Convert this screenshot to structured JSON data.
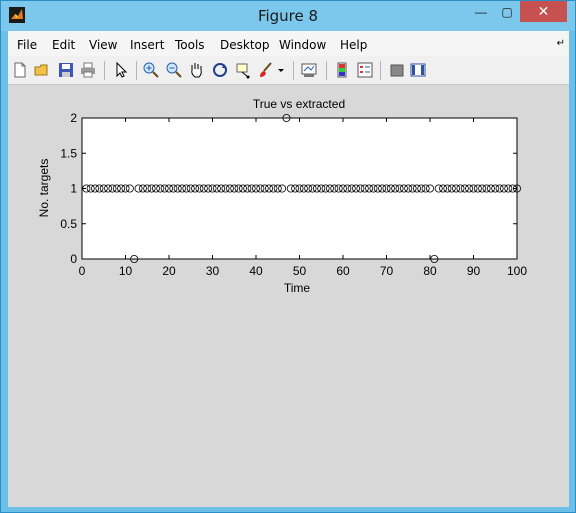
{
  "window": {
    "title": "Figure 8",
    "close_glyph": "✕",
    "min_glyph": "—",
    "max_glyph": "▢"
  },
  "menu": [
    "File",
    "Edit",
    "View",
    "Insert",
    "Tools",
    "Desktop",
    "Window",
    "Help"
  ],
  "toolbar_icons": [
    "new-figure-icon",
    "open-file-icon",
    "save-icon",
    "print-icon",
    "pointer-icon",
    "zoom-in-icon",
    "zoom-out-icon",
    "pan-hand-icon",
    "rotate-3d-icon",
    "data-cursor-icon",
    "brush-icon",
    "dropdown-arrow-icon",
    "link-plot-icon",
    "insert-colorbar-icon",
    "insert-legend-icon",
    "hide-plot-tools-icon",
    "show-plot-tools-icon"
  ],
  "chart_data": {
    "type": "scatter",
    "title": "True vs extracted",
    "xlabel": "Time",
    "ylabel": "No. targets",
    "xlim": [
      0,
      100
    ],
    "ylim": [
      0,
      2
    ],
    "xticks": [
      "0",
      "10",
      "20",
      "30",
      "40",
      "50",
      "60",
      "70",
      "80",
      "90",
      "100"
    ],
    "yticks": [
      "0",
      "0.5",
      "1",
      "1.5",
      "2"
    ],
    "grid": false,
    "marker": "o",
    "series": [
      {
        "x_start": 1,
        "x_end": 100,
        "y": 1,
        "exceptions": [
          {
            "x": 12,
            "y": 0
          },
          {
            "x": 47,
            "y": 2
          },
          {
            "x": 81,
            "y": 0
          }
        ]
      }
    ]
  }
}
